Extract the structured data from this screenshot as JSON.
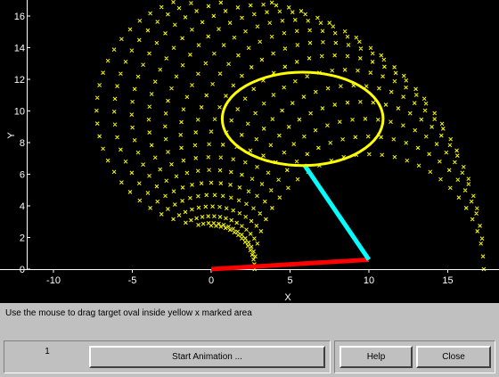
{
  "plot": {
    "xlabel": "X",
    "ylabel": "Y",
    "x_ticks": [
      "-10",
      "-5",
      "0",
      "5",
      "10",
      "15"
    ],
    "y_ticks": [
      "0",
      "2",
      "4",
      "6",
      "8",
      "10",
      "12",
      "14",
      "16"
    ],
    "xlim": [
      -11.5,
      18.2
    ],
    "ylim": [
      0,
      16.8
    ],
    "colors": {
      "background": "#000000",
      "axes": "#ffffff",
      "workspace_marks": "#ffff00",
      "target_oval": "#ffff00",
      "link1": "#ff0000",
      "link2": "#00ffff"
    },
    "arm": {
      "base": [
        0,
        0
      ],
      "elbow": [
        10,
        0.6
      ],
      "end_effector": [
        5.9,
        6.6
      ]
    },
    "target_oval": {
      "center": [
        5.8,
        9.5
      ],
      "rx": 5.1,
      "ry": 2.95
    }
  },
  "status": {
    "message": "Use the mouse to drag target oval inside yellow x marked area"
  },
  "controls": {
    "counter_value": "1",
    "start_button": "Start Animation ...",
    "help_button": "Help",
    "close_button": "Close"
  }
}
